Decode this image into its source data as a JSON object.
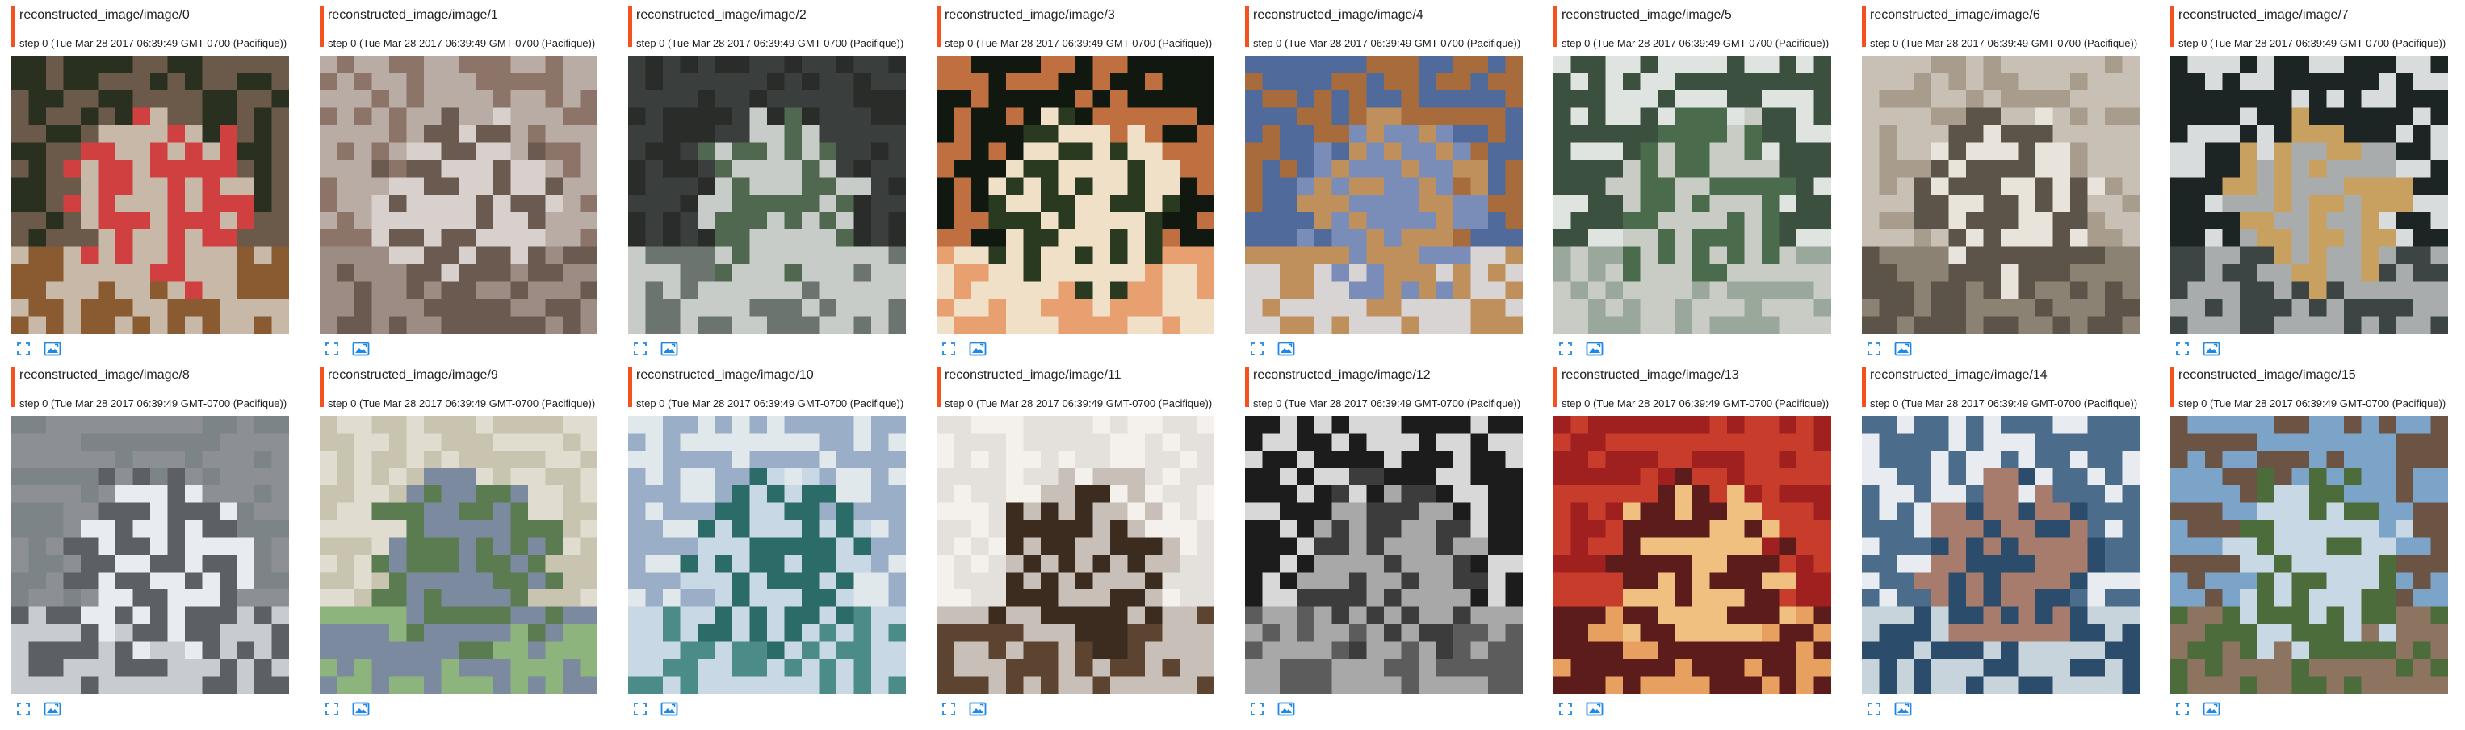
{
  "colors": {
    "accent": "#f4511e",
    "icon": "#1e88e5"
  },
  "cards": [
    {
      "title": "reconstructed_image/image/0",
      "step": "step 0 (Tue Mar 28 2017 06:39:49 GMT-0700 (Pacifique))",
      "palette": [
        "#6b5a4a",
        "#8a5a30",
        "#c8b8a8",
        "#d04040",
        "#2a3020"
      ]
    },
    {
      "title": "reconstructed_image/image/1",
      "step": "step 0 (Tue Mar 28 2017 06:39:49 GMT-0700 (Pacifique))",
      "palette": [
        "#b8aca4",
        "#9c8c84",
        "#6a5a50",
        "#d8d0cc",
        "#8c7468"
      ]
    },
    {
      "title": "reconstructed_image/image/2",
      "step": "step 0 (Tue Mar 28 2017 06:39:49 GMT-0700 (Pacifique))",
      "palette": [
        "#3a3e3c",
        "#6c7470",
        "#c8ccc8",
        "#506850",
        "#2a2c2a"
      ]
    },
    {
      "title": "reconstructed_image/image/3",
      "step": "step 0 (Tue Mar 28 2017 06:39:49 GMT-0700 (Pacifique))",
      "palette": [
        "#101810",
        "#e8a070",
        "#f0e0c8",
        "#2a3a20",
        "#c07040"
      ]
    },
    {
      "title": "reconstructed_image/image/4",
      "step": "step 0 (Tue Mar 28 2017 06:39:49 GMT-0700 (Pacifique))",
      "palette": [
        "#506a9c",
        "#d8d4d4",
        "#c0905c",
        "#7a8cb8",
        "#a86c3c"
      ]
    },
    {
      "title": "reconstructed_image/image/5",
      "step": "step 0 (Tue Mar 28 2017 06:39:49 GMT-0700 (Pacifique))",
      "palette": [
        "#3c5040",
        "#9aa89c",
        "#c8ccc4",
        "#4a6c4c",
        "#e0e4e0"
      ]
    },
    {
      "title": "reconstructed_image/image/6",
      "step": "step 0 (Tue Mar 28 2017 06:39:49 GMT-0700 (Pacifique))",
      "palette": [
        "#c8c0b4",
        "#8c8274",
        "#5c5448",
        "#e8e4dc",
        "#a89c8c"
      ]
    },
    {
      "title": "reconstructed_image/image/7",
      "step": "step 0 (Tue Mar 28 2017 06:39:49 GMT-0700 (Pacifique))",
      "palette": [
        "#1c2424",
        "#3c4444",
        "#a8acac",
        "#c8a060",
        "#d8dcdc"
      ]
    },
    {
      "title": "reconstructed_image/image/8",
      "step": "step 0 (Tue Mar 28 2017 06:39:49 GMT-0700 (Pacifique))",
      "palette": [
        "#8c9094",
        "#c8ccd0",
        "#5c6064",
        "#e8ecf0",
        "#7c8488"
      ]
    },
    {
      "title": "reconstructed_image/image/9",
      "step": "step 0 (Tue Mar 28 2017 06:39:49 GMT-0700 (Pacifique))",
      "palette": [
        "#c8c4b0",
        "#8cb47c",
        "#7c8aa0",
        "#5a7c50",
        "#e0dcd0"
      ]
    },
    {
      "title": "reconstructed_image/image/10",
      "step": "step 0 (Tue Mar 28 2017 06:39:49 GMT-0700 (Pacifique))",
      "palette": [
        "#9aaec8",
        "#4c8c88",
        "#c8d8e4",
        "#2c6c68",
        "#e0e8ec"
      ]
    },
    {
      "title": "reconstructed_image/image/11",
      "step": "step 0 (Tue Mar 28 2017 06:39:49 GMT-0700 (Pacifique))",
      "palette": [
        "#e4e0dc",
        "#5c4430",
        "#c8c0b8",
        "#3c2c20",
        "#f4f0ec"
      ]
    },
    {
      "title": "reconstructed_image/image/12",
      "step": "step 0 (Tue Mar 28 2017 06:39:49 GMT-0700 (Pacifique))",
      "palette": [
        "#1c1c1c",
        "#5c5c5c",
        "#a8a8a8",
        "#3c3c3c",
        "#d8d8d8"
      ]
    },
    {
      "title": "reconstructed_image/image/13",
      "step": "step 0 (Tue Mar 28 2017 06:39:49 GMT-0700 (Pacifique))",
      "palette": [
        "#c83c2c",
        "#e8a060",
        "#5c1c1c",
        "#f0c080",
        "#a02020"
      ]
    },
    {
      "title": "reconstructed_image/image/14",
      "step": "step 0 (Tue Mar 28 2017 06:39:49 GMT-0700 (Pacifique))",
      "palette": [
        "#4c6c8c",
        "#c8d4dc",
        "#2c4c6c",
        "#a87c6c",
        "#e8ecf0"
      ]
    },
    {
      "title": "reconstructed_image/image/15",
      "step": "step 0 (Tue Mar 28 2017 06:39:49 GMT-0700 (Pacifique))",
      "palette": [
        "#7ca4c8",
        "#8c7460",
        "#4c6c3c",
        "#c8d8e4",
        "#6c5444"
      ]
    }
  ]
}
